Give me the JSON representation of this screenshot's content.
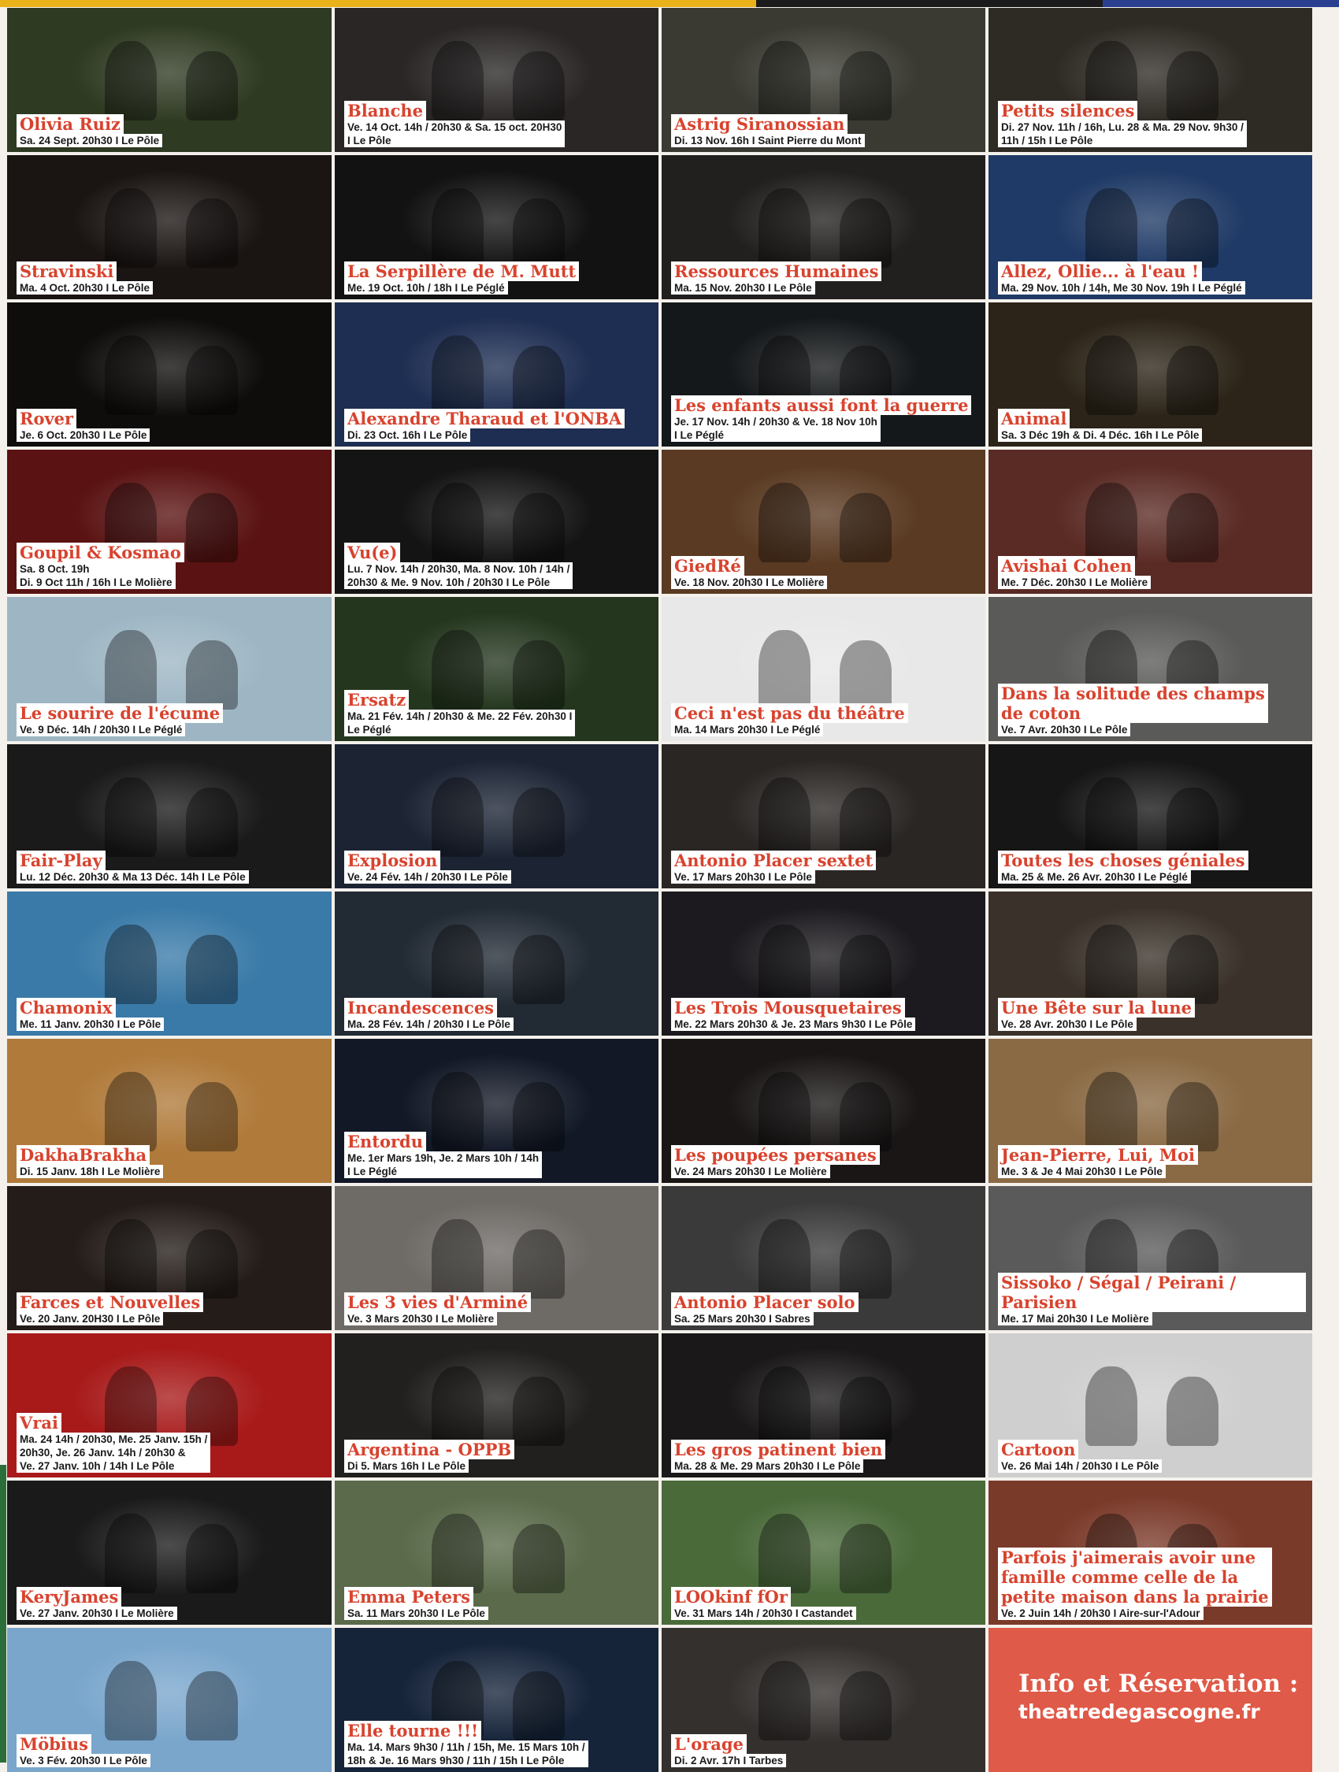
{
  "colors": {
    "title_text": "#d8432e",
    "caption_background": "#ffffff",
    "info_background": "#df5a48",
    "top_bar_yellow": "#e9b21b",
    "top_bar_blue": "#2a3f8f"
  },
  "events": [
    {
      "title": "Olivia Ruiz",
      "date": "Sa. 24 Sept. 20h30 I Le Pôle",
      "bg": "#2f3a22"
    },
    {
      "title": "Blanche",
      "date": "Ve. 14 Oct. 14h / 20h30 & Sa. 15 oct. 20H30\nI Le Pôle",
      "bg": "#2a2626"
    },
    {
      "title": "Astrig Siranossian",
      "date": "Di. 13 Nov. 16h I Saint Pierre du Mont",
      "bg": "#3a3a32"
    },
    {
      "title": "Petits silences",
      "date": "Di. 27 Nov. 11h / 16h, Lu. 28 & Ma. 29 Nov. 9h30 /\n11h / 15h I Le Pôle",
      "bg": "#2e2a24"
    },
    {
      "title": "Stravinski",
      "date": "Ma. 4 Oct. 20h30 I Le Pôle",
      "bg": "#1a1412"
    },
    {
      "title": "La Serpillère de M. Mutt",
      "date": "Me. 19 Oct. 10h / 18h I Le Péglé",
      "bg": "#121212"
    },
    {
      "title": "Ressources Humaines",
      "date": "Ma. 15 Nov. 20h30 I Le Pôle",
      "bg": "#22201e"
    },
    {
      "title": "Allez, Ollie... à l'eau !",
      "date": "Ma. 29 Nov. 10h / 14h, Me 30 Nov. 19h I Le Péglé",
      "bg": "#1f3a66"
    },
    {
      "title": "Rover",
      "date": "Je. 6 Oct. 20h30 I Le Pôle",
      "bg": "#0f0d0c"
    },
    {
      "title": "Alexandre Tharaud et l'ONBA",
      "date": "Di. 23 Oct. 16h I Le Pôle",
      "bg": "#1e2e52"
    },
    {
      "title": "Les enfants aussi font la guerre",
      "date": "Je. 17 Nov. 14h / 20h30 & Ve. 18 Nov 10h\nI Le Péglé",
      "bg": "#15181a"
    },
    {
      "title": "Animal",
      "date": "Sa. 3 Déc 19h & Di. 4 Déc. 16h I Le Pôle",
      "bg": "#2c2418"
    },
    {
      "title": "Goupil & Kosmao",
      "date": "Sa. 8 Oct. 19h\nDi. 9 Oct 11h / 16h I Le Molière",
      "bg": "#5a1212"
    },
    {
      "title": "Vu(e)",
      "date": "Lu. 7 Nov. 14h / 20h30, Ma. 8 Nov. 10h / 14h /\n20h30 & Me. 9 Nov. 10h / 20h30 I Le Pôle",
      "bg": "#141414"
    },
    {
      "title": "GiedRé",
      "date": "Ve. 18 Nov. 20h30 I Le Molière",
      "bg": "#5a3a22"
    },
    {
      "title": "Avishai Cohen",
      "date": "Me. 7 Déc. 20h30 I Le Molière",
      "bg": "#5a2a24"
    },
    {
      "title": "Le sourire de l'écume",
      "date": "Ve. 9 Déc. 14h / 20h30 I Le Péglé",
      "bg": "#9eb6c4"
    },
    {
      "title": "Ersatz",
      "date": "Ma. 21 Fév. 14h / 20h30 & Me. 22 Fév. 20h30 I\nLe Péglé",
      "bg": "#24361e"
    },
    {
      "title": "Ceci n'est pas du théâtre",
      "date": "Ma. 14 Mars 20h30 I Le Péglé",
      "bg": "#e8e8e8"
    },
    {
      "title": "Dans la solitude des champs\nde coton",
      "date": "Ve. 7 Avr. 20h30 I Le Pôle",
      "bg": "#5a5a58"
    },
    {
      "title": "Fair-Play",
      "date": "Lu. 12 Déc. 20h30 & Ma 13 Déc. 14h I Le Pôle",
      "bg": "#1a1a1a"
    },
    {
      "title": "Explosion",
      "date": "Ve. 24 Fév. 14h / 20h30 I Le Pôle",
      "bg": "#1c2434"
    },
    {
      "title": "Antonio Placer sextet",
      "date": "Ve. 17 Mars 20h30 I Le Pôle",
      "bg": "#2a2624"
    },
    {
      "title": "Toutes les choses géniales",
      "date": "Ma. 25 & Me. 26 Avr. 20h30 I Le Péglé",
      "bg": "#161616"
    },
    {
      "title": "Chamonix",
      "date": "Me. 11 Janv. 20h30 I Le Pôle",
      "bg": "#3a7aa8"
    },
    {
      "title": "Incandescences",
      "date": "Ma. 28 Fév. 14h / 20h30 I Le Pôle",
      "bg": "#222a34"
    },
    {
      "title": "Les Trois Mousquetaires",
      "date": "Me. 22 Mars 20h30 & Je. 23 Mars 9h30 I Le Pôle",
      "bg": "#1c1a1e"
    },
    {
      "title": "Une Bête sur la lune",
      "date": "Ve. 28 Avr. 20h30 I Le Pôle",
      "bg": "#3a322a"
    },
    {
      "title": "DakhaBrakha",
      "date": "Di. 15 Janv. 18h I Le Molière",
      "bg": "#b07a3a"
    },
    {
      "title": "Entordu",
      "date": "Me. 1er Mars 19h, Je. 2 Mars 10h / 14h\nI Le Péglé",
      "bg": "#121826"
    },
    {
      "title": "Les poupées persanes",
      "date": "Ve. 24 Mars 20h30 I Le Molière",
      "bg": "#1a1616"
    },
    {
      "title": "Jean-Pierre, Lui, Moi",
      "date": "Me. 3 & Je 4 Mai 20h30 I Le Pôle",
      "bg": "#8a6a44"
    },
    {
      "title": "Farces et Nouvelles",
      "date": "Ve. 20 Janv. 20H30 I Le Pôle",
      "bg": "#241c18"
    },
    {
      "title": "Les 3 vies d'Arminé",
      "date": "Ve. 3 Mars 20h30 I Le Molière",
      "bg": "#6e6a66"
    },
    {
      "title": "Antonio Placer solo",
      "date": "Sa. 25 Mars 20h30 I Sabres",
      "bg": "#3a3a3a"
    },
    {
      "title": "Sissoko / Ségal / Peirani / Parisien",
      "date": "Me. 17 Mai 20h30 I Le Molière",
      "bg": "#5a5a5a"
    },
    {
      "title": "Vrai",
      "date": "Ma. 24 14h / 20h30, Me. 25 Janv. 15h /\n20h30, Je. 26 Janv. 14h / 20h30 &\nVe. 27 Janv. 10h / 14h I Le Pôle",
      "bg": "#a81a1a"
    },
    {
      "title": "Argentina - OPPB",
      "date": "Di 5. Mars 16h I Le Pôle",
      "bg": "#22201e"
    },
    {
      "title": "Les gros patinent bien",
      "date": "Ma. 28 & Me. 29 Mars 20h30 I Le Pôle",
      "bg": "#1a1818"
    },
    {
      "title": "Cartoon",
      "date": "Ve. 26 Mai 14h / 20h30 I Le Pôle",
      "bg": "#cfcfcf"
    },
    {
      "title": "KeryJames",
      "date": "Ve. 27 Janv. 20h30 I Le Molière",
      "bg": "#1a1a1a"
    },
    {
      "title": "Emma Peters",
      "date": "Sa. 11 Mars 20h30 I Le Pôle",
      "bg": "#5a6a4a"
    },
    {
      "title": "LOOkinf fOr",
      "date": "Ve. 31 Mars 14h / 20h30 I Castandet",
      "bg": "#4a6a3a"
    },
    {
      "title": "Parfois j'aimerais avoir une\nfamille comme celle de la\npetite maison dans la prairie",
      "date": "Ve. 2 Juin 14h / 20h30 I Aire-sur-l'Adour",
      "bg": "#7a3a2a"
    },
    {
      "title": "Möbius",
      "date": "Ve. 3 Fév. 20h30 I Le Pôle",
      "bg": "#7aa6cc"
    },
    {
      "title": "Elle tourne !!!",
      "date": "Ma. 14. Mars 9h30 / 11h / 15h, Me. 15 Mars 10h /\n18h & Je. 16 Mars 9h30 / 11h / 15h I Le Pôle",
      "bg": "#16243a"
    },
    {
      "title": "L'orage",
      "date": "Di. 2 Avr. 17h I Tarbes",
      "bg": "#34302e"
    }
  ],
  "info": {
    "heading": "Info et Réservation :",
    "url": "theatredegascogne.fr"
  }
}
